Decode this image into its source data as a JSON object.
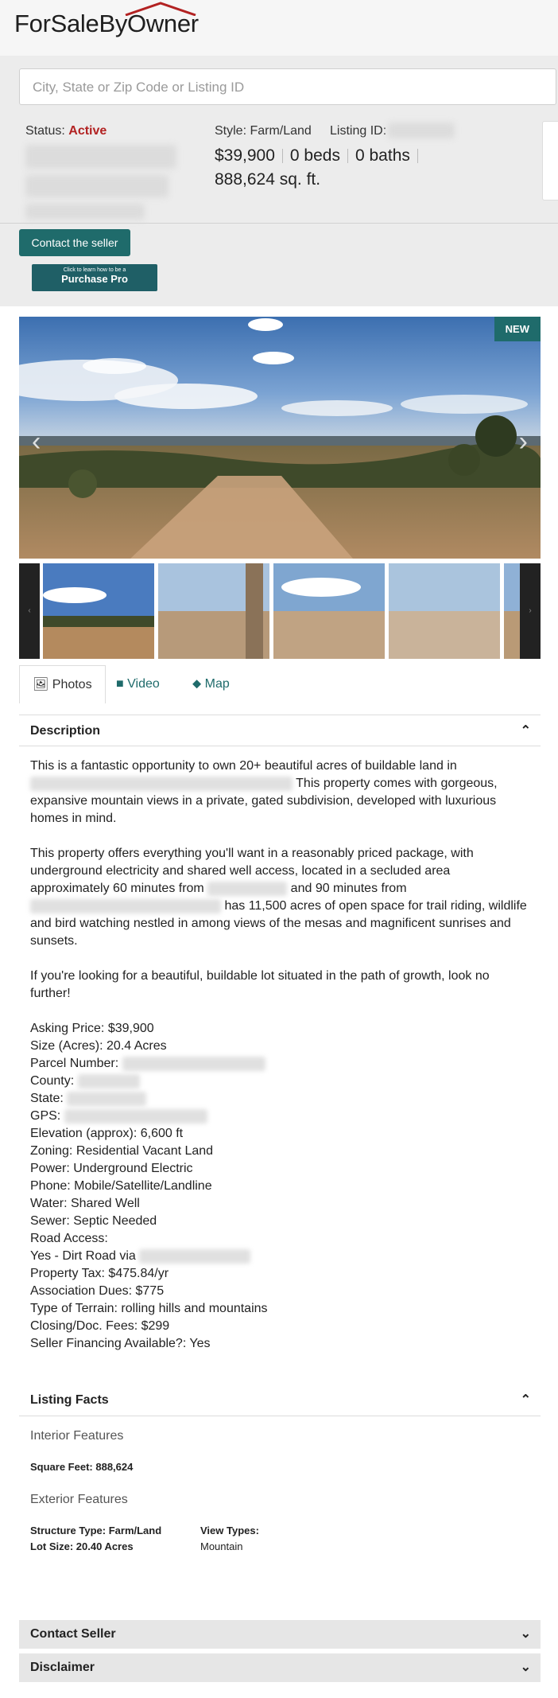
{
  "header": {
    "logo": "ForSaleByOwner"
  },
  "search": {
    "placeholder": "City, State or Zip Code or Listing ID"
  },
  "summary": {
    "status_label": "Status:",
    "status_value": "Active",
    "style": "Style: Farm/Land",
    "listing_id_label": "Listing ID:",
    "price": "$39,900",
    "beds": "0 beds",
    "baths": "0 baths",
    "sqft": "888,624 sq. ft."
  },
  "buttons": {
    "contact": "Contact the seller",
    "pro_small": "Click to learn how to be a",
    "pro_big": "Purchase Pro"
  },
  "photo": {
    "badge": "NEW"
  },
  "tabs": {
    "photos": "Photos",
    "video": "Video",
    "map": "Map"
  },
  "description": {
    "heading": "Description",
    "p1a": "This is a fantastic opportunity to own 20+ beautiful acres of buildable land in",
    "p1b": "This property comes with gorgeous, expansive mountain views in a private, gated subdivision, developed with luxurious homes in mind.",
    "p2a": "This property offers everything you'll want in a reasonably priced package, with underground electricity and shared well access, located in a secluded area approximately 60 minutes from",
    "p2b": "and 90 minutes from",
    "p2c": "has 11,500 acres of open space for trail riding, wildlife and bird watching nestled in among views of the mesas and magnificent sunrises and sunsets.",
    "p3": "If you're looking for a beautiful, buildable lot situated in the path of growth, look no further!",
    "list": [
      "Asking Price: $39,900",
      "Size (Acres): 20.4 Acres",
      "Parcel Number:",
      "County:",
      "State:",
      "GPS:",
      "Elevation (approx): 6,600 ft",
      "Zoning: Residential Vacant Land",
      "Power: Underground Electric",
      "Phone: Mobile/Satellite/Landline",
      "Water: Shared Well",
      "Sewer: Septic Needed",
      "Road Access:",
      "Yes - Dirt Road via",
      "Property Tax: $475.84/yr",
      "Association Dues: $775",
      "Type of Terrain: rolling hills and mountains",
      "Closing/Doc. Fees: $299",
      "Seller Financing Available?: Yes"
    ]
  },
  "facts": {
    "heading": "Listing Facts",
    "interior_title": "Interior Features",
    "sqft_label": "Square Feet: 888,624",
    "exterior_title": "Exterior Features",
    "structure": "Structure Type: Farm/Land",
    "lot": "Lot Size: 20.40 Acres",
    "view_label": "View Types:",
    "view_value": "Mountain"
  },
  "accordion": {
    "contact": "Contact Seller",
    "disclaimer": "Disclaimer"
  },
  "colors": {
    "accent": "#1f6b6b",
    "status": "#b22222"
  }
}
